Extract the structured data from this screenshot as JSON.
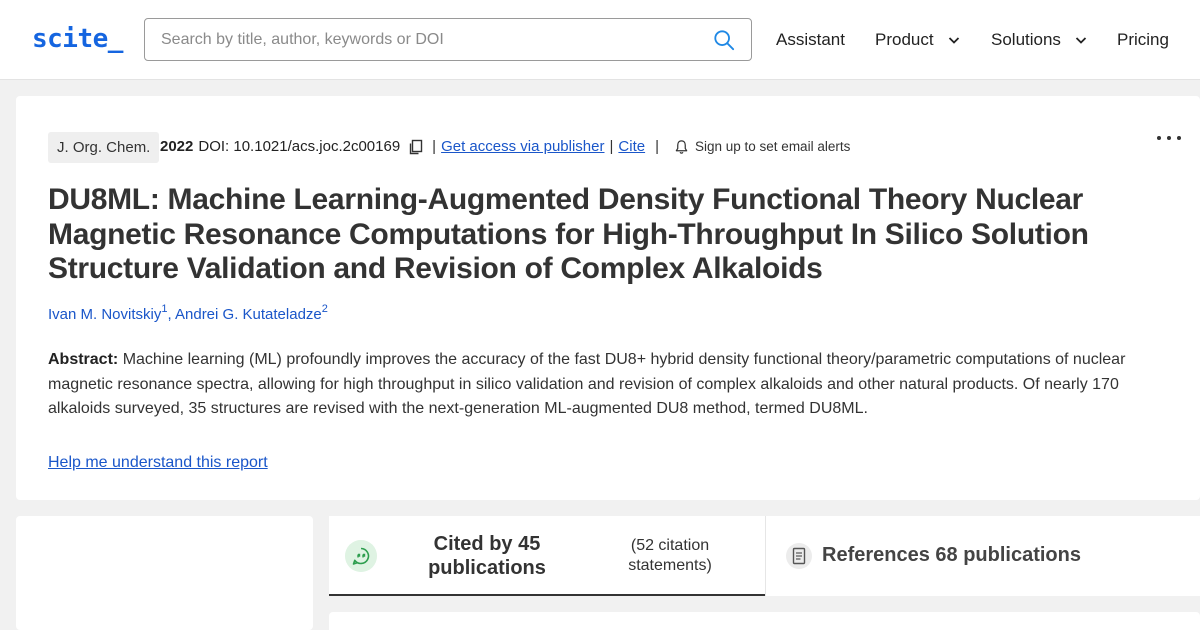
{
  "header": {
    "logo": "scite_",
    "search_placeholder": "Search by title, author, keywords or DOI",
    "nav": {
      "assistant": "Assistant",
      "product": "Product",
      "solutions": "Solutions",
      "pricing": "Pricing"
    }
  },
  "article": {
    "journal": "J. Org. Chem.",
    "year": "2022",
    "doi": "DOI: 10.1021/acs.joc.2c00169",
    "access_link": "Get access via publisher",
    "cite_link": "Cite",
    "alerts_text": "Sign up to set email alerts",
    "title": "DU8ML: Machine Learning-Augmented Density Functional Theory Nuclear Magnetic Resonance Computations for High-Throughput In Silico Solution Structure Validation and Revision of Complex Alkaloids",
    "authors": [
      {
        "name": "Ivan M. Novitskiy",
        "sup": "1"
      },
      {
        "name": "Andrei G. Kutateladze",
        "sup": "2"
      }
    ],
    "abstract_label": "Abstract:",
    "abstract_text": "Machine learning (ML) profoundly improves the accuracy of the fast DU8+ hybrid density functional theory/parametric computations of nuclear magnetic resonance spectra, allowing for high throughput in silico validation and revision of complex alkaloids and other natural products. Of nearly 170 alkaloids surveyed, 35 structures are revised with the next-generation ML-augmented DU8 method, termed DU8ML.",
    "help_link": "Help me understand this report"
  },
  "tabs": {
    "cited_title": "Cited by 45 publications",
    "cited_sub": "(52 citation statements)",
    "refs_title": "References 68 publications"
  },
  "colors": {
    "brand": "#1565e0",
    "link": "#1a56c9",
    "quote_badge_bg": "#dff3e3",
    "quote_badge_icon": "#2e9e4f"
  },
  "icons": {
    "search": "search-icon",
    "copy": "copy-icon",
    "bell": "bell-icon",
    "more": "more-icon",
    "quote": "quote-bubble-icon",
    "document": "document-icon",
    "chevron": "chevron-down-icon"
  }
}
